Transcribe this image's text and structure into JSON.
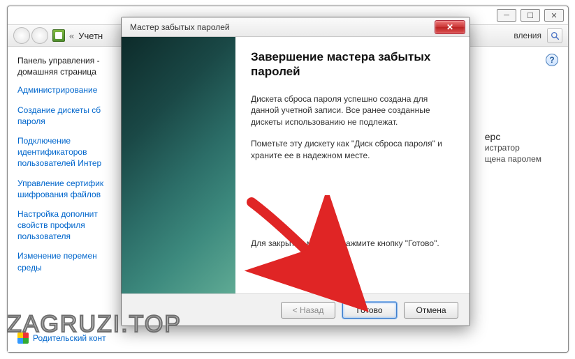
{
  "cp": {
    "win_minimize": "─",
    "win_maximize": "☐",
    "win_close": "✕",
    "breadcrumb_prefix": "«",
    "breadcrumb": "Учетн",
    "toolbar_right_text": "вления",
    "heading_line1": "Панель управления -",
    "heading_line2": "домашняя страница",
    "links": [
      "Администрирование",
      "Создание дискеты сб\nпароля",
      "Подключение идентификаторов пользователей Интер",
      "Управление сертифик\nшифрования файлов",
      "Настройка дополнит\nсвойств профиля пользователя",
      "Изменение перемен\nсреды"
    ],
    "footer_link": "Родительский конт",
    "main_frag1": "ерс",
    "main_frag2": "истратор",
    "main_frag3": "щена паролем",
    "help_glyph": "?"
  },
  "wizard": {
    "title": "Мастер забытых паролей",
    "close_glyph": "✕",
    "heading": "Завершение мастера забытых паролей",
    "p1": "Дискета сброса пароля успешно создана для данной учетной записи. Все ранее созданные дискеты использованию не подлежат.",
    "p2": "Пометьте эту дискету как \"Диск сброса пароля\" и храните ее в надежном месте.",
    "p3": "Для закрытия мастера нажмите кнопку \"Готово\".",
    "btn_back": "< Назад",
    "btn_finish": "Готово",
    "btn_cancel": "Отмена"
  },
  "watermark": "ZAGRUZI.TOP"
}
